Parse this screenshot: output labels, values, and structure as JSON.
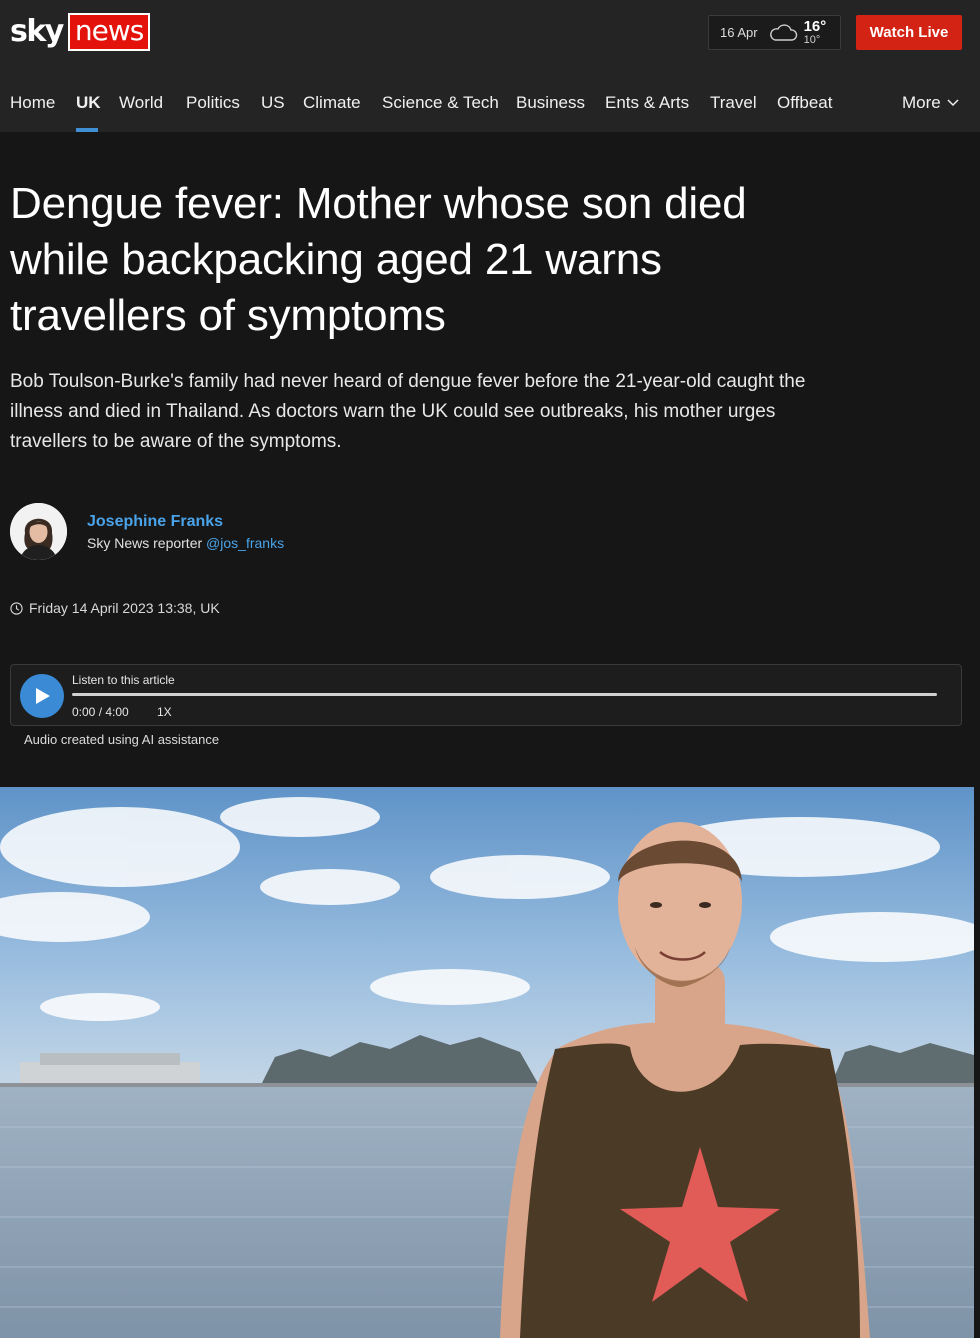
{
  "header": {
    "logo": {
      "sky": "sky",
      "news": "news"
    },
    "weather": {
      "date": "16 Apr",
      "high": "16°",
      "low": "10°",
      "icon": "cloud-icon"
    },
    "watch_live_label": "Watch Live"
  },
  "nav": {
    "items": [
      {
        "label": "Home"
      },
      {
        "label": "UK",
        "active": true
      },
      {
        "label": "World"
      },
      {
        "label": "Politics"
      },
      {
        "label": "US"
      },
      {
        "label": "Climate"
      },
      {
        "label": "Science & Tech"
      },
      {
        "label": "Business"
      },
      {
        "label": "Ents & Arts"
      },
      {
        "label": "Travel"
      },
      {
        "label": "Offbeat"
      }
    ],
    "more_label": "More"
  },
  "article": {
    "headline": "Dengue fever: Mother whose son died while backpacking aged 21 warns travellers of symptoms",
    "standfirst": "Bob Toulson-Burke's family had never heard of dengue fever before the 21-year-old caught the illness and died in Thailand. As doctors warn the UK could see outbreaks, his mother urges travellers to be aware of the symptoms.",
    "author": {
      "name": "Josephine Franks",
      "role": "Sky News reporter",
      "handle": "@jos_franks"
    },
    "timestamp": "Friday 14 April 2023 13:38, UK",
    "audio": {
      "listen_label": "Listen to this article",
      "time": "0:00 / 4:00",
      "speed": "1X",
      "progress_percent": 0,
      "note": "Audio created using AI assistance"
    }
  },
  "colors": {
    "background": "#161616",
    "header": "#242424",
    "accent_blue": "#3b8ad6",
    "brand_red": "#d32314"
  }
}
